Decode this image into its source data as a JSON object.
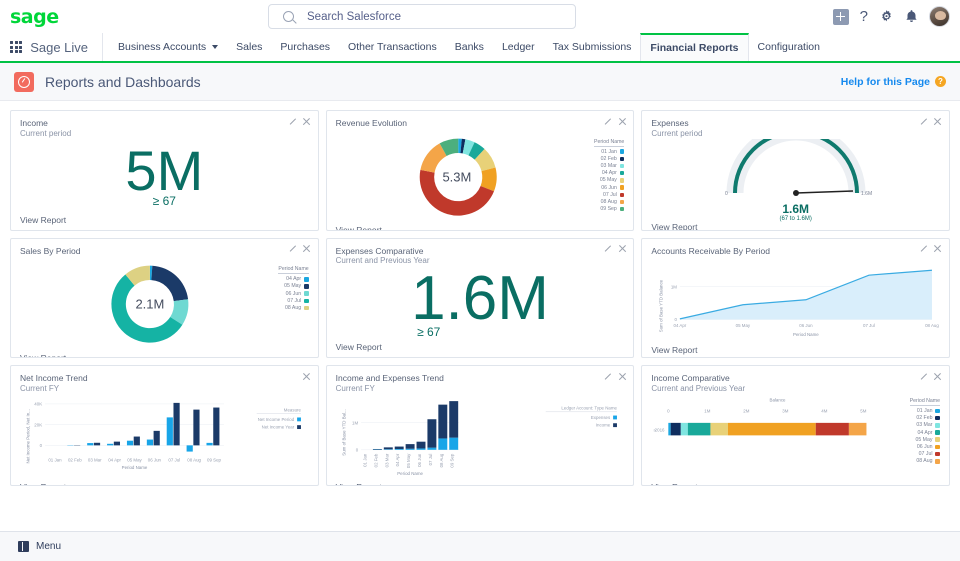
{
  "topbar": {
    "logo_text": "sage",
    "search": {
      "placeholder": "Search Salesforce",
      "value": ""
    },
    "icons": [
      "add-icon",
      "help-icon",
      "setup-gear-icon",
      "notifications-bell-icon",
      "user-avatar"
    ],
    "help_symbol": "?"
  },
  "nav": {
    "app_name": "Sage Live",
    "tabs": [
      {
        "label": "Business Accounts",
        "has_caret": true,
        "active": false
      },
      {
        "label": "Sales",
        "has_caret": false,
        "active": false
      },
      {
        "label": "Purchases",
        "has_caret": false,
        "active": false
      },
      {
        "label": "Other Transactions",
        "has_caret": false,
        "active": false
      },
      {
        "label": "Banks",
        "has_caret": false,
        "active": false
      },
      {
        "label": "Ledger",
        "has_caret": false,
        "active": false
      },
      {
        "label": "Tax Submissions",
        "has_caret": false,
        "active": false
      },
      {
        "label": "Financial Reports",
        "has_caret": false,
        "active": true
      },
      {
        "label": "Configuration",
        "has_caret": false,
        "active": false
      }
    ]
  },
  "page_header": {
    "title": "Reports and Dashboards",
    "help_link": "Help for this Page",
    "help_badge": "?"
  },
  "common": {
    "view_report": "View Report"
  },
  "footer": {
    "menu_label": "Menu"
  },
  "tiles": [
    {
      "title": "Income",
      "subtitle": "Current period",
      "metric_value": "5M",
      "metric_sub": "≥ 67"
    },
    {
      "title": "Revenue Evolution",
      "subtitle": "",
      "center_label": "5.3M",
      "legend_title": "Period Name"
    },
    {
      "title": "Expenses",
      "subtitle": "Current period",
      "gauge_value": "1.6M",
      "gauge_range": "(67 to 1.6M)",
      "gauge_min": "0",
      "gauge_max": "1.6M"
    },
    {
      "title": "Sales By Period",
      "subtitle": "",
      "center_label": "2.1M",
      "legend_title": "Period Name"
    },
    {
      "title": "Expenses Comparative",
      "subtitle": "Current and Previous Year",
      "metric_value": "1.6M",
      "metric_sub": "≥ 67"
    },
    {
      "title": "Accounts Receivable By Period",
      "subtitle": "",
      "ylabel": "Sum of Base YTD Balance",
      "xlabel": "Period Name"
    },
    {
      "title": "Net Income Trend",
      "subtitle": "Current FY",
      "ylabel": "Net Income Period, Net In...",
      "xlabel": "Period Name",
      "legend_title": "Measure"
    },
    {
      "title": "Income and Expenses Trend",
      "subtitle": "Current FY",
      "ylabel": "Sum of Base YTD Bal...",
      "xlabel": "Period Name",
      "legend_title": "Ledger Account: Type Name"
    },
    {
      "title": "Income Comparative",
      "subtitle": "Current and Previous Year",
      "axis_title": "Balance",
      "row_label": "2016",
      "legend_title": "Period Name"
    }
  ],
  "chart_data": [
    {
      "id": "revenue-evolution",
      "type": "pie",
      "title": "Revenue Evolution",
      "center_label": "5.3M",
      "legend_title": "Period Name",
      "legend_position": "right",
      "categories": [
        "01 Jan",
        "02 Feb",
        "03 Mar",
        "04 Apr",
        "05 May",
        "06 Jun",
        "07 Jul",
        "08 Aug",
        "09 Sep"
      ],
      "values": [
        1.5,
        1.5,
        4,
        5,
        9,
        10,
        47,
        14,
        8
      ],
      "colors": [
        "#1ba7e0",
        "#0f2d5e",
        "#7fe5e0",
        "#19a99a",
        "#e8d178",
        "#f0a122",
        "#c0392b",
        "#f4a548",
        "#4caf7d"
      ]
    },
    {
      "id": "sales-by-period",
      "type": "pie",
      "title": "Sales By Period",
      "center_label": "2.1M",
      "legend_title": "Period Name",
      "legend_position": "right",
      "categories": [
        "04 Apr",
        "05 May",
        "06 Jun",
        "07 Jul",
        "08 Aug"
      ],
      "values": [
        1,
        22,
        11,
        55,
        11
      ],
      "colors": [
        "#1ba7e0",
        "#1b3a68",
        "#6fd9d2",
        "#15b3a4",
        "#ddd183"
      ]
    },
    {
      "id": "expenses-gauge",
      "type": "gauge",
      "title": "Expenses",
      "value_label": "1.6M",
      "range_label": "(67 to 1.6M)",
      "min_label": "0",
      "max_label": "1.6M",
      "min": 0,
      "max": 1.6,
      "value": 1.6,
      "color": "#0f7a6e"
    },
    {
      "id": "accounts-receivable-by-period",
      "type": "area",
      "title": "Accounts Receivable By Period",
      "xlabel": "Period Name",
      "ylabel": "Sum of Base YTD Balance",
      "categories": [
        "04 Apr",
        "05 May",
        "06 Jun",
        "07 Jul",
        "08 Aug"
      ],
      "values": [
        0.02,
        0.45,
        0.6,
        1.35,
        1.5
      ],
      "yticks": [
        0,
        1
      ],
      "ytick_labels": [
        "0",
        "1M"
      ],
      "ylim": [
        0,
        1.7
      ],
      "grid": true,
      "color": "#3aabe2",
      "fill": "#d9eefb"
    },
    {
      "id": "net-income-trend",
      "type": "bar",
      "title": "Net Income Trend",
      "subtitle": "Current FY",
      "xlabel": "Period Name",
      "ylabel": "Net Income Period, Net In...",
      "legend_title": "Measure",
      "categories": [
        "01 Jan",
        "02 Feb",
        "03 Mar",
        "04 Apr",
        "05 May",
        "06 Jun",
        "07 Jul",
        "08 Aug",
        "09 Sep"
      ],
      "yticks": [
        0,
        20000,
        40000
      ],
      "ytick_labels": [
        "0",
        "20K",
        "40K"
      ],
      "ylim": [
        -8000,
        44000
      ],
      "series": [
        {
          "name": "Net Income Period",
          "color": "#18a5e8",
          "values": [
            0,
            300,
            2200,
            1500,
            4500,
            5600,
            27000,
            -6000,
            2400
          ]
        },
        {
          "name": "Net Income Year",
          "color": "#1b3a68",
          "values": [
            0,
            300,
            2500,
            3600,
            8500,
            14000,
            41000,
            34500,
            36500
          ]
        }
      ]
    },
    {
      "id": "income-and-expenses-trend",
      "type": "bar",
      "title": "Income and Expenses Trend",
      "subtitle": "Current FY",
      "xlabel": "Period Name",
      "ylabel": "Sum of Base YTD Bal...",
      "legend_title": "Ledger Account: Type Name",
      "stacked": true,
      "categories": [
        "01 Jan",
        "02 Feb",
        "03 Mar",
        "04 Apr",
        "05 May",
        "06 Jun",
        "07 Jul",
        "08 Aug",
        "09 Sep"
      ],
      "yticks": [
        0,
        1
      ],
      "ytick_labels": [
        "0",
        "1M"
      ],
      "ylim": [
        0,
        1.85
      ],
      "series": [
        {
          "name": "Expenses",
          "color": "#18a5e8",
          "values": [
            0,
            0.01,
            0.02,
            0.03,
            0.04,
            0.05,
            0.08,
            0.42,
            0.45
          ]
        },
        {
          "name": "Income",
          "color": "#1b3a68",
          "values": [
            0.005,
            0.02,
            0.07,
            0.09,
            0.17,
            0.25,
            1.05,
            1.25,
            1.35
          ]
        }
      ]
    },
    {
      "id": "income-comparative",
      "type": "bar",
      "title": "Income Comparative",
      "subtitle": "Current and Previous Year",
      "orientation": "horizontal",
      "stacked": true,
      "axis_title": "Balance",
      "row_label": "2016",
      "legend_title": "Period Name",
      "xticks": [
        0,
        1,
        2,
        3,
        4,
        5
      ],
      "xtick_labels": [
        "0",
        "1M",
        "2M",
        "3M",
        "4M",
        "5M"
      ],
      "xlim": [
        0,
        5.6
      ],
      "categories": [
        "01 Jan",
        "02 Feb",
        "03 Mar",
        "04 Apr",
        "05 May",
        "06 Jun",
        "07 Jul",
        "08 Aug"
      ],
      "values": [
        0.06,
        0.26,
        0.18,
        0.58,
        0.45,
        2.25,
        0.85,
        0.45
      ],
      "colors": [
        "#1ba7e0",
        "#0f2d5e",
        "#7fe5e0",
        "#19a99a",
        "#e8d178",
        "#f0a122",
        "#c0392b",
        "#f4a548"
      ]
    }
  ]
}
